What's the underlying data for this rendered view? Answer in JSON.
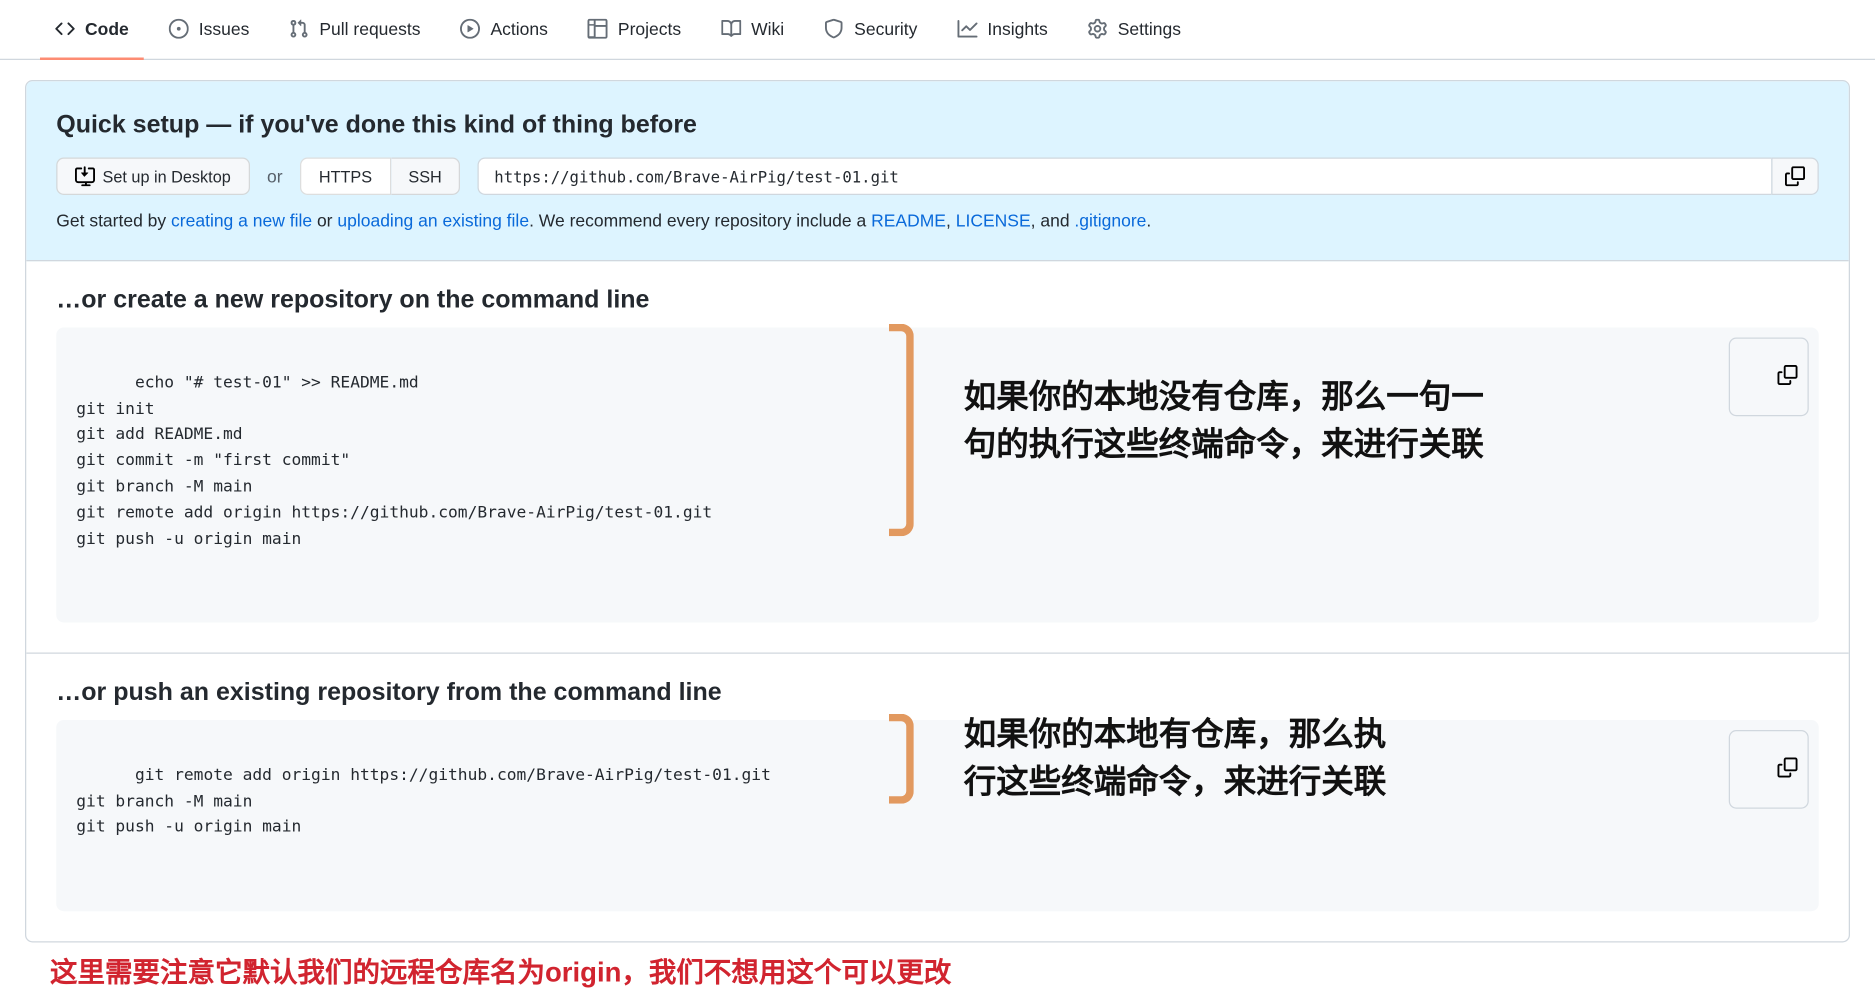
{
  "nav": {
    "tabs": [
      {
        "label": "Code"
      },
      {
        "label": "Issues"
      },
      {
        "label": "Pull requests"
      },
      {
        "label": "Actions"
      },
      {
        "label": "Projects"
      },
      {
        "label": "Wiki"
      },
      {
        "label": "Security"
      },
      {
        "label": "Insights"
      },
      {
        "label": "Settings"
      }
    ]
  },
  "quick_setup": {
    "heading": "Quick setup — if you've done this kind of thing before",
    "desktop_btn": "Set up in Desktop",
    "or": "or",
    "https_btn": "HTTPS",
    "ssh_btn": "SSH",
    "clone_url": "https://github.com/Brave-AirPig/test-01.git",
    "helper_prefix": "Get started by ",
    "link_create": "creating a new file",
    "helper_or": " or ",
    "link_upload": "uploading an existing file",
    "helper_mid": ". We recommend every repository include a ",
    "link_readme": "README",
    "comma1": ", ",
    "link_license": "LICENSE",
    "comma2": ", and ",
    "link_gitignore": ".gitignore",
    "period": "."
  },
  "section_create": {
    "heading": "…or create a new repository on the command line",
    "code": "echo \"# test-01\" >> README.md\ngit init\ngit add README.md\ngit commit -m \"first commit\"\ngit branch -M main\ngit remote add origin https://github.com/Brave-AirPig/test-01.git\ngit push -u origin main",
    "annotation": "如果你的本地没有仓库，那么一句一\n句的执行这些终端命令，来进行关联"
  },
  "section_push": {
    "heading": "…or push an existing repository from the command line",
    "code": "git remote add origin https://github.com/Brave-AirPig/test-01.git\ngit branch -M main\ngit push -u origin main",
    "annotation": "如果你的本地有仓库，那么执\n行这些终端命令，来进行关联"
  },
  "bottom_note": "这里需要注意它默认我们的远程仓库名为origin，我们不想用这个可以更改"
}
